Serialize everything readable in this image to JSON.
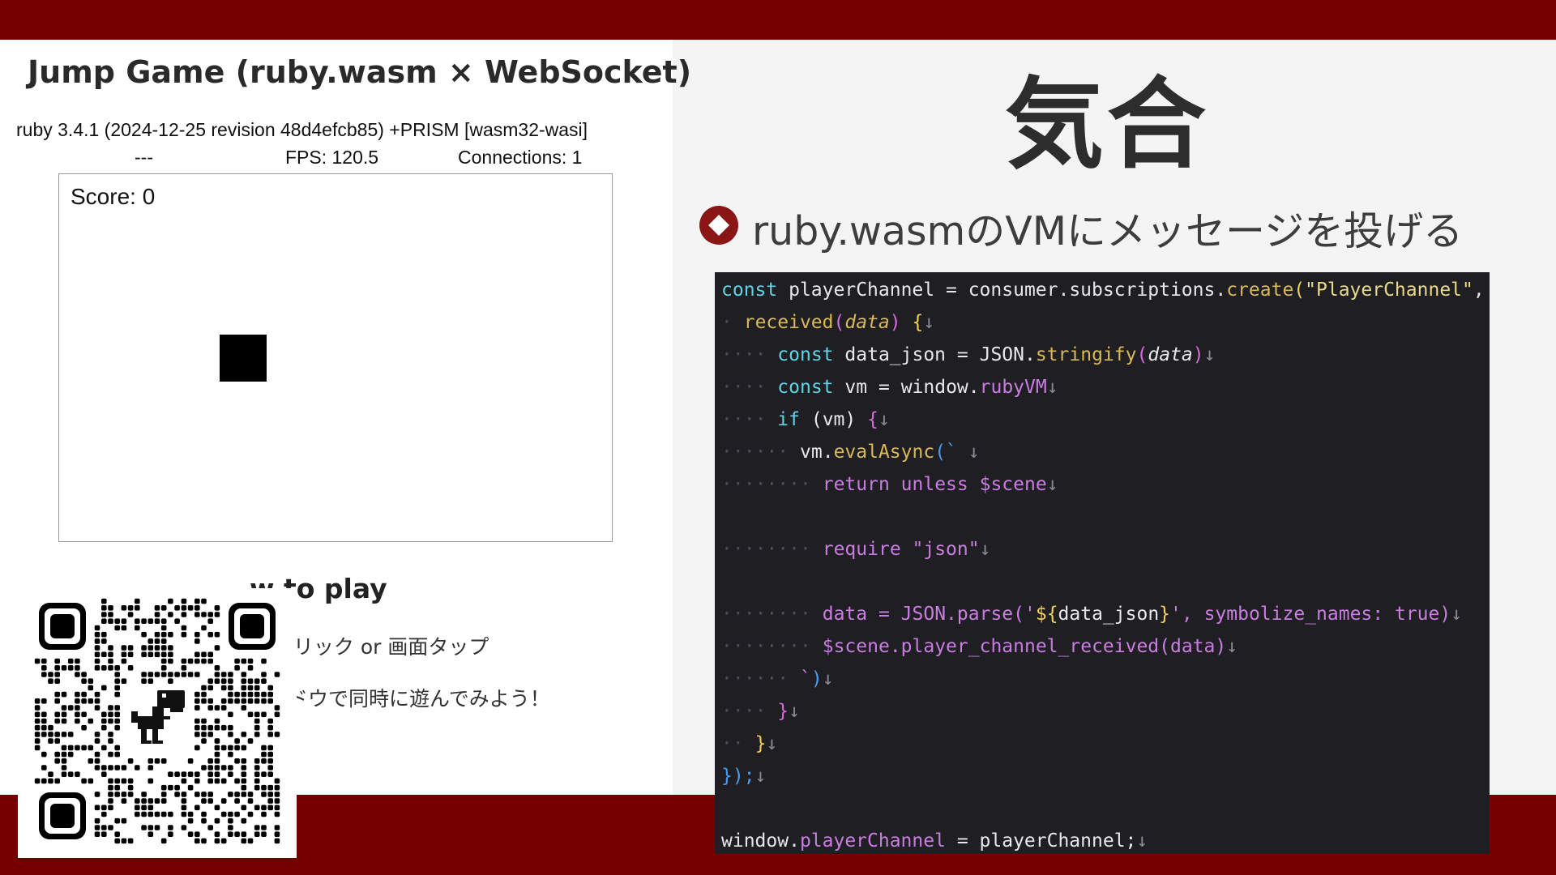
{
  "game": {
    "title": "Jump Game (ruby.wasm × WebSocket)",
    "ruby_version": "ruby 3.4.1 (2024-12-25 revision 48d4efcb85) +PRISM [wasm32-wasi]",
    "status_dash": "---",
    "fps": "FPS: 120.5",
    "connections": "Connections: 1",
    "score": "Score: 0",
    "howto_title": "w to play",
    "howto_line1": "'リック or 画面タップ",
    "howto_line2": "ドウで同時に遊んでみよう！"
  },
  "slide": {
    "title": "気合",
    "bullet": "ruby.wasmのVMにメッセージを投げる"
  },
  "code": {
    "l1": [
      "const",
      "playerChannel",
      "=",
      "consumer.subscriptions.",
      "create",
      "(",
      "\"PlayerChannel\"",
      ",",
      "{"
    ],
    "l2": [
      "received",
      "(",
      "data",
      ")",
      "{"
    ],
    "l3": [
      "const",
      "data_json",
      "=",
      "JSON.",
      "stringify",
      "(",
      "data",
      ")"
    ],
    "l4": [
      "const",
      "vm",
      "=",
      "window.",
      "rubyVM"
    ],
    "l5": [
      "if",
      "(vm)",
      "{"
    ],
    "l6": [
      "vm.",
      "evalAsync",
      "(`"
    ],
    "l7": [
      "return unless $scene"
    ],
    "l9": [
      "require \"json\""
    ],
    "l11": [
      "data = JSON.parse('",
      "${",
      "data_json",
      "}",
      "', symbolize_names: true)"
    ],
    "l12": [
      "$scene.player_channel_received(data)"
    ],
    "l13": [
      "`",
      ")"
    ],
    "l14": [
      "}"
    ],
    "l15": [
      "}"
    ],
    "l16": [
      "});"
    ],
    "l18": [
      "window.",
      "playerChannel",
      "=",
      "playerChannel;"
    ],
    "newline_glyph": "↓",
    "space_glyph": "·"
  },
  "colors": {
    "brand_band": "#750000",
    "editor_bg": "#1f1f23",
    "keyword": "#5fd4e6",
    "function": "#d8b85a",
    "method": "#c97de0"
  },
  "icons": {
    "bullet": "ruby-diamond-icon",
    "qr": "qr-code-icon",
    "dino": "dino-icon"
  }
}
